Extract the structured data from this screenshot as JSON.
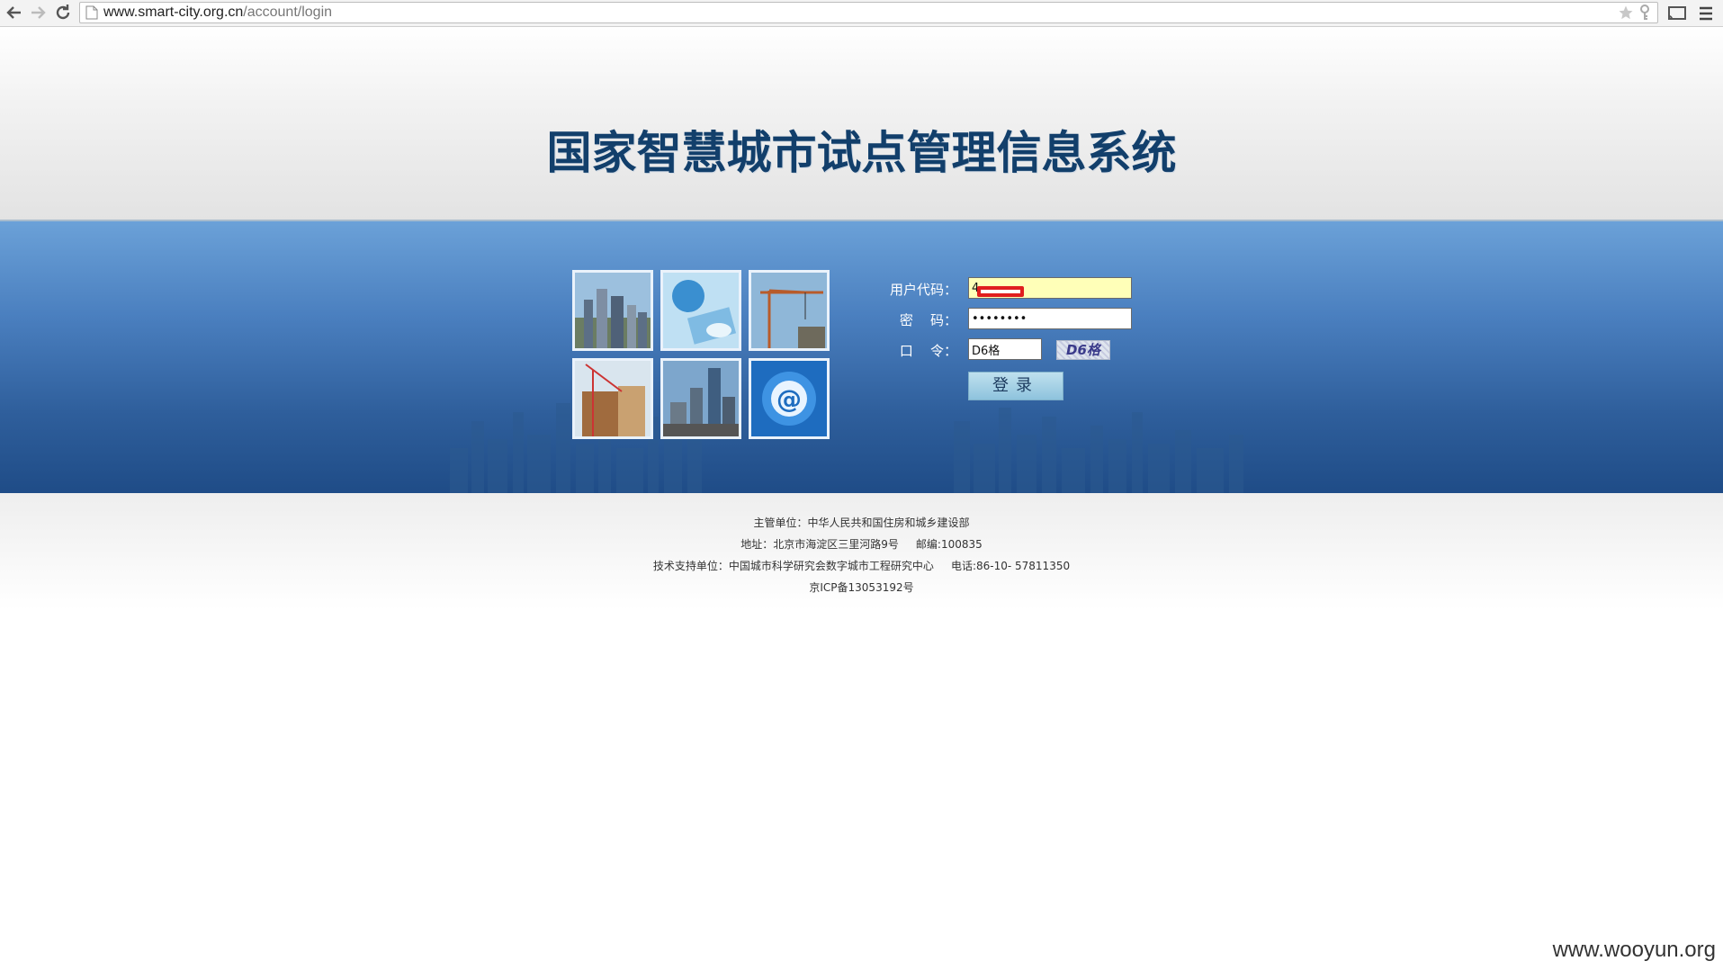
{
  "browser": {
    "url_host": "www.smart-city.org.cn",
    "url_path": "/account/login"
  },
  "header": {
    "title": "国家智慧城市试点管理信息系统"
  },
  "login": {
    "user_label": "用户代码：",
    "user_value": "4",
    "password_label": "密    码：",
    "password_value": "••••••••",
    "code_label": "口    令：",
    "code_value": "D6格",
    "captcha_text": "D6格",
    "submit_label": "登录"
  },
  "footer": {
    "line1": "主管单位：中华人民共和国住房和城乡建设部",
    "line2": "地址：北京市海淀区三里河路9号     邮编:100835",
    "line3": "技术支持单位：中国城市科学研究会数字城市工程研究中心     电话:86-10- 57811350",
    "line4": "京ICP备13053192号"
  },
  "watermark": "www.wooyun.org",
  "colors": {
    "title": "#123f6b",
    "band_top": "#6ba1d8",
    "band_bottom": "#1f4c87",
    "user_field_bg": "#ffffb8"
  }
}
